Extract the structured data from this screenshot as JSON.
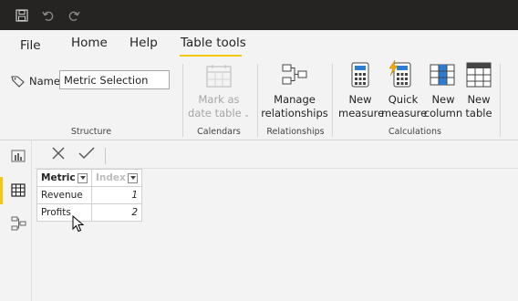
{
  "quick_access": {
    "save_icon": "save-icon",
    "undo_icon": "undo-icon",
    "redo_icon": "redo-icon"
  },
  "tabs": [
    {
      "label": "File"
    },
    {
      "label": "Home"
    },
    {
      "label": "Help"
    },
    {
      "label": "Table tools",
      "active": true
    }
  ],
  "accent_color": "#f2c811",
  "structure": {
    "name_label": "Name",
    "name_value": "Metric Selection",
    "group_label": "Structure"
  },
  "calendars": {
    "mark_as_date_table": "Mark as date table",
    "group_label": "Calendars"
  },
  "relationships": {
    "manage_relationships": "Manage relationships",
    "group_label": "Relationships"
  },
  "calculations": {
    "new_measure": "New measure",
    "quick_measure": "Quick measure",
    "new_column": "New column",
    "new_table": "New table",
    "group_label": "Calculations"
  },
  "table": {
    "columns": [
      "Metric",
      "Index"
    ],
    "rows": [
      {
        "metric": "Revenue",
        "index": "1"
      },
      {
        "metric": "Profits",
        "index": "2"
      }
    ]
  }
}
